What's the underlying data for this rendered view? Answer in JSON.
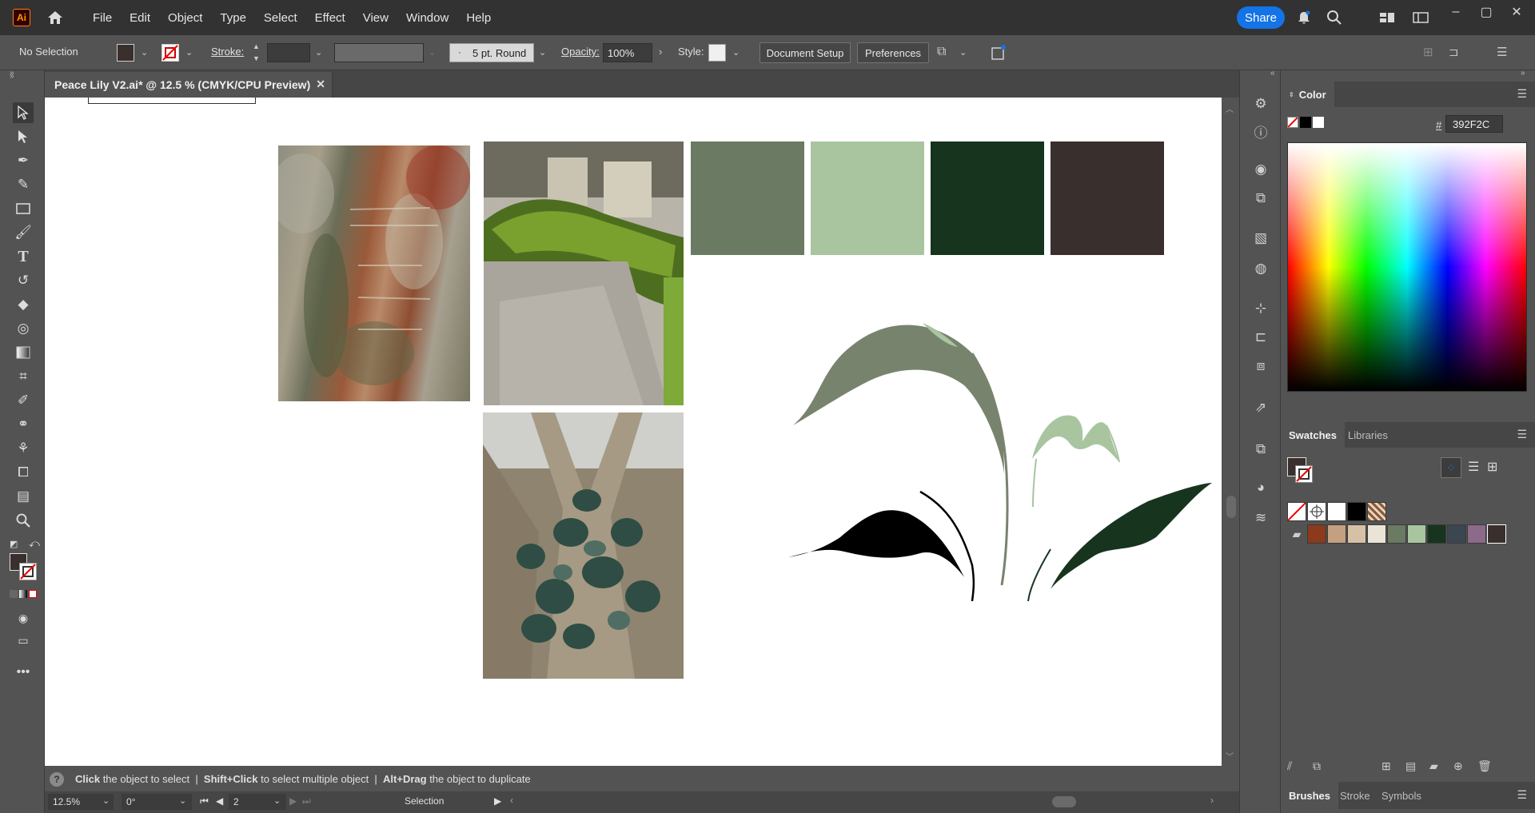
{
  "app": {
    "logo_text": "Ai"
  },
  "menu": [
    "File",
    "Edit",
    "Object",
    "Type",
    "Select",
    "Effect",
    "View",
    "Window",
    "Help"
  ],
  "share_label": "Share",
  "control": {
    "selection_text": "No Selection",
    "stroke_label": "Stroke:",
    "brush_label": "5 pt. Round",
    "opacity_label": "Opacity:",
    "opacity_value": "100%",
    "style_label": "Style:",
    "document_setup_label": "Document Setup",
    "preferences_label": "Preferences"
  },
  "document_tab": {
    "title": "Peace Lily V2.ai* @ 12.5 % (CMYK/CPU Preview)"
  },
  "color_panel": {
    "title": "Color",
    "hex_prefix": "#",
    "hex_value": "392F2C"
  },
  "swatches_panel": {
    "tabs": [
      "Swatches",
      "Libraries"
    ],
    "colors": [
      "#ffffff",
      "#000000",
      "#8b3a1b",
      "#c4a080",
      "#d6c1a6",
      "#eae4d6",
      "#6b7a62",
      "#a8c5a0",
      "#17341f",
      "#3a4650",
      "#8b6a8a",
      "#392f2c"
    ]
  },
  "bottom_panel": {
    "tabs": [
      "Brushes",
      "Stroke",
      "Symbols"
    ]
  },
  "moodboard": {
    "palette": [
      "#6b7a62",
      "#a8c5a0",
      "#17341f",
      "#392f2c"
    ],
    "leaf_colors": [
      "#78836e",
      "#a8c5a0",
      "#000000",
      "#17341f"
    ]
  },
  "hint": {
    "bold1": "Click",
    "text1": " the object to select  |  ",
    "bold2": "Shift+Click",
    "text2": " to select multiple object  |  ",
    "bold3": "Alt+Drag",
    "text3": " the object to duplicate"
  },
  "status": {
    "zoom": "12.5%",
    "rotation": "0°",
    "artboard": "2",
    "tool": "Selection"
  }
}
